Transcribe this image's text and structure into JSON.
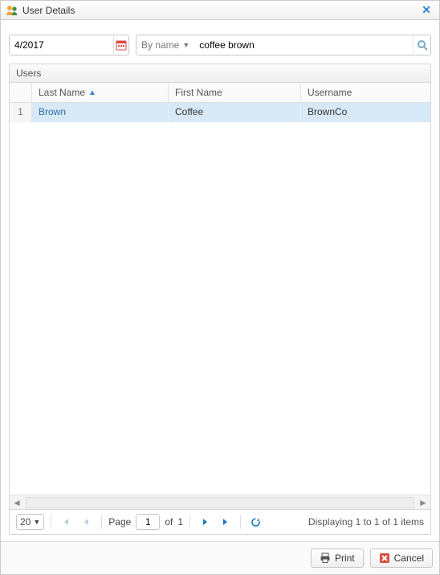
{
  "window": {
    "title": "User Details"
  },
  "filters": {
    "date_value": "4/2017",
    "search_mode_label": "By name",
    "search_value": "coffee brown"
  },
  "grid": {
    "title": "Users",
    "columns": {
      "last_name": "Last Name",
      "first_name": "First Name",
      "username": "Username"
    },
    "rows": [
      {
        "n": "1",
        "last_name": "Brown",
        "first_name": "Coffee",
        "username": "BrownCo"
      }
    ]
  },
  "pager": {
    "page_size": "20",
    "page_label": "Page",
    "current_page": "1",
    "of_label": "of",
    "total_pages": "1",
    "display_text": "Displaying 1 to 1 of 1 items"
  },
  "footer": {
    "print_label": "Print",
    "cancel_label": "Cancel"
  }
}
